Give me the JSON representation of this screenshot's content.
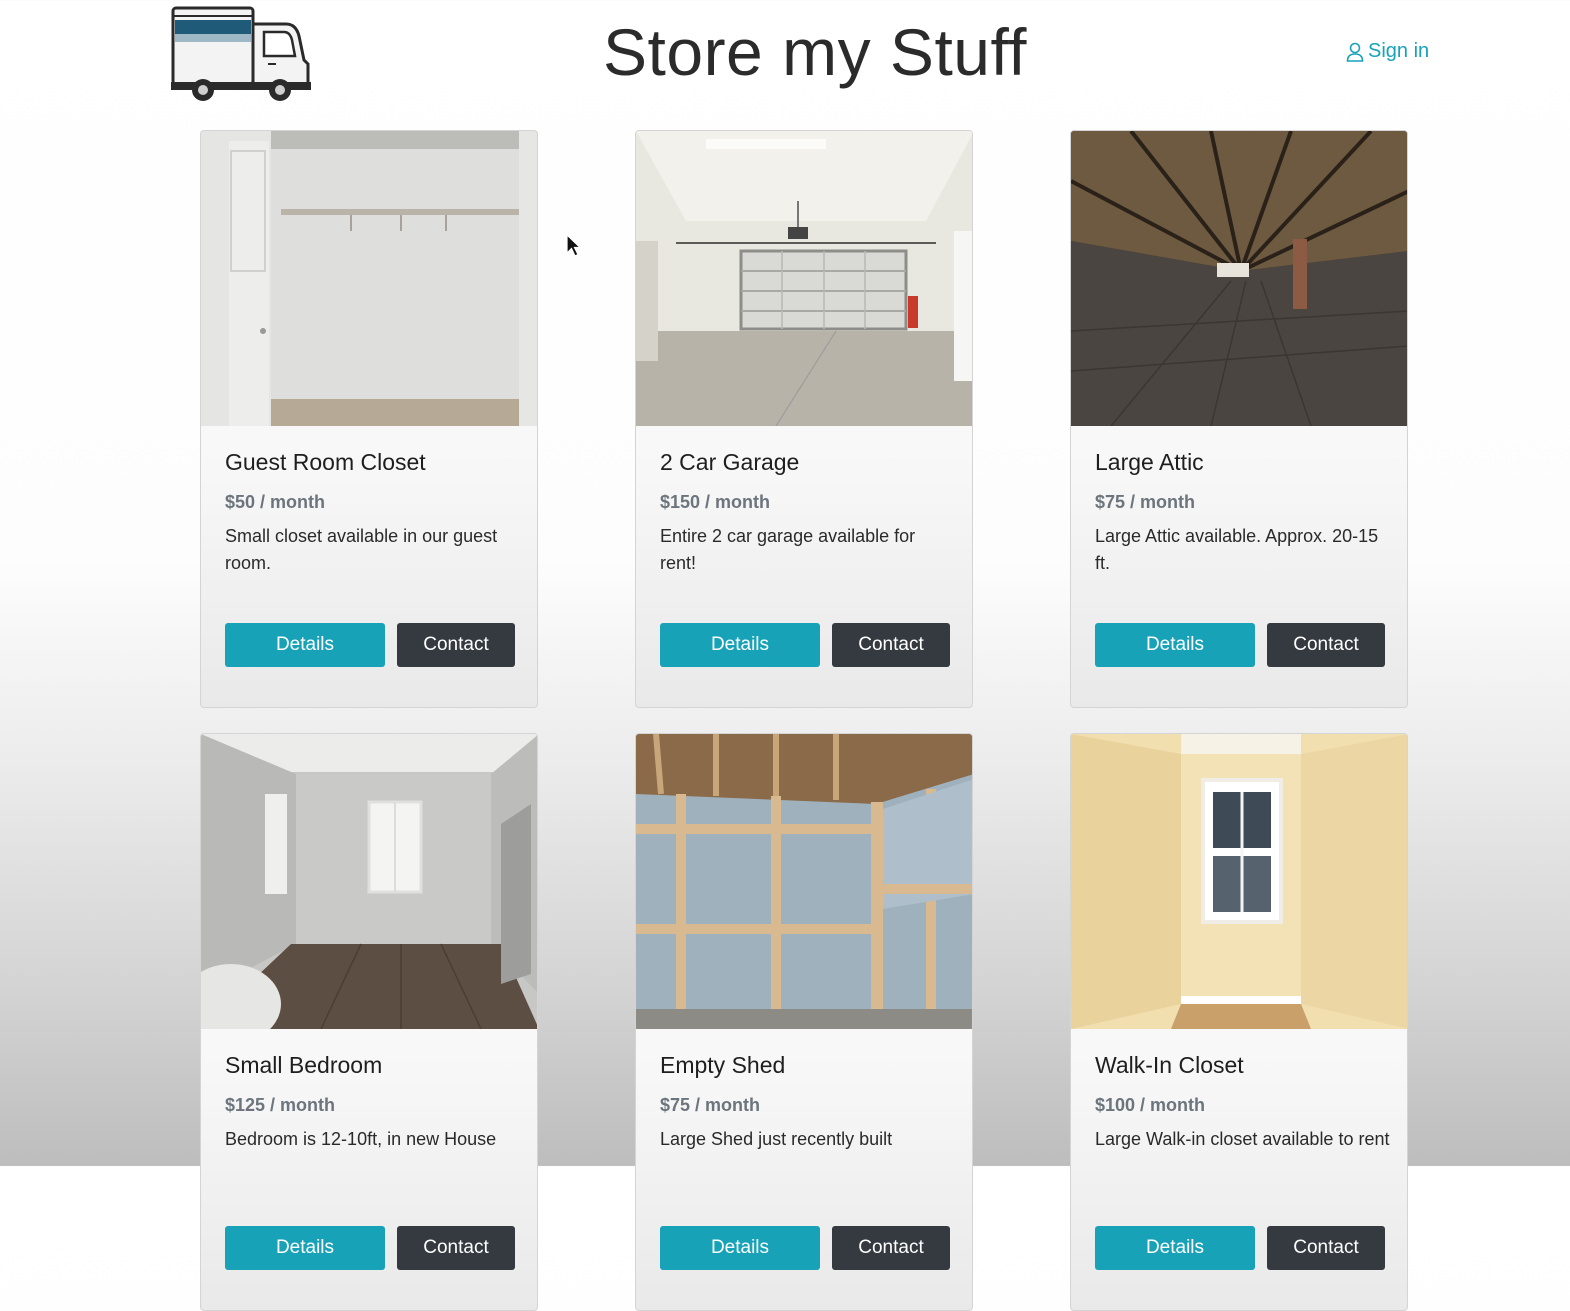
{
  "header": {
    "title": "Store my Stuff",
    "signin_label": "Sign in",
    "logo_icon": "moving-truck-icon",
    "user_icon": "user-icon"
  },
  "colors": {
    "accent": "#17a2b8",
    "dark_button": "#343a40",
    "price": "#6c757d"
  },
  "listings": [
    {
      "title": "Guest Room Closet",
      "price": "$50 / month",
      "description": "Small closet available in our guest room.",
      "details_label": "Details",
      "contact_label": "Contact",
      "image": "closet-photo"
    },
    {
      "title": "2 Car Garage",
      "price": "$150 / month",
      "description": "Entire 2 car garage available for rent!",
      "details_label": "Details",
      "contact_label": "Contact",
      "image": "garage-photo"
    },
    {
      "title": "Large Attic",
      "price": "$75 / month",
      "description": "Large Attic available. Approx. 20-15 ft.",
      "details_label": "Details",
      "contact_label": "Contact",
      "image": "attic-photo"
    },
    {
      "title": "Small Bedroom",
      "price": "$125 / month",
      "description": "Bedroom is 12-10ft, in new House",
      "details_label": "Details",
      "contact_label": "Contact",
      "image": "bedroom-photo"
    },
    {
      "title": "Empty Shed",
      "price": "$75 / month",
      "description": "Large Shed just recently built",
      "details_label": "Details",
      "contact_label": "Contact",
      "image": "shed-photo"
    },
    {
      "title": "Walk-In Closet",
      "price": "$100 / month",
      "description": "Large Walk-in closet available to rent",
      "details_label": "Details",
      "contact_label": "Contact",
      "image": "walk-in-closet-photo"
    }
  ]
}
